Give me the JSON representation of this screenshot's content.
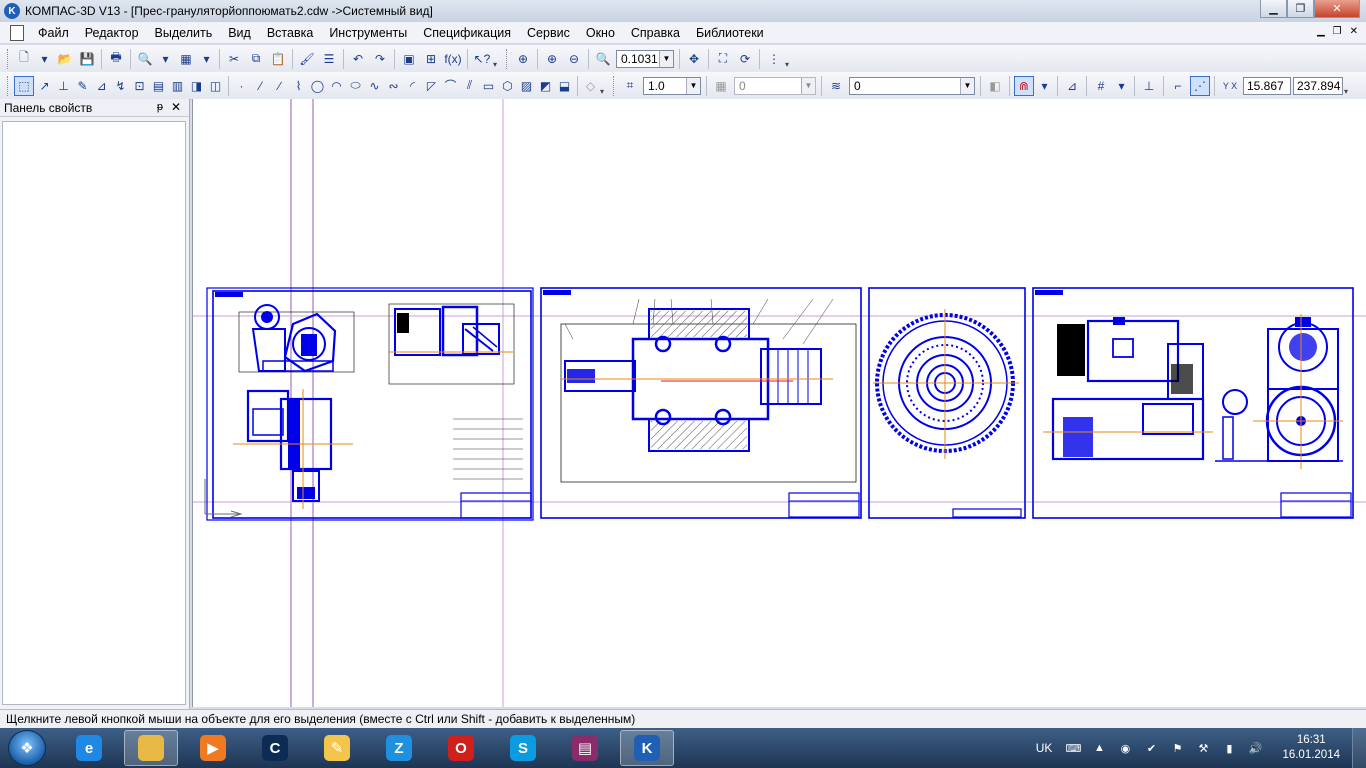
{
  "window": {
    "title": "КОМПАС-3D V13 - [Прес-грануляторйоппоюмать2.cdw ->Системный вид]",
    "minimize_icon": "minimize-icon",
    "maximize_icon": "maximize-icon",
    "close_icon": "close-icon"
  },
  "menu": {
    "items": [
      "Файл",
      "Редактор",
      "Выделить",
      "Вид",
      "Вставка",
      "Инструменты",
      "Спецификация",
      "Сервис",
      "Окно",
      "Справка",
      "Библиотеки"
    ]
  },
  "toolbar1": {
    "zoom_value": "0.1031"
  },
  "toolbar2": {
    "step_value": "1.0",
    "layer_value": "0",
    "style_value": "0",
    "coord_x": "15.867",
    "coord_y": "237.894",
    "coord_label": "Y X"
  },
  "property_panel": {
    "title": "Панель свойств",
    "pin_glyph": "ᵽ",
    "close_glyph": "✕"
  },
  "status": {
    "text": "Щелкните левой кнопкой мыши на объекте для его выделения (вместе с Ctrl или Shift - добавить к выделенным)"
  },
  "taskbar": {
    "apps": [
      {
        "name": "internet-explorer",
        "label": "e",
        "color": "#1e88e5"
      },
      {
        "name": "file-explorer",
        "label": "",
        "color": "#e8b847"
      },
      {
        "name": "media-player",
        "label": "▶",
        "color": "#f07a1f"
      },
      {
        "name": "ccleaner",
        "label": "C",
        "color": "#0c2c55"
      },
      {
        "name": "notepad-plus",
        "label": "✎",
        "color": "#f3c64b"
      },
      {
        "name": "zona",
        "label": "Z",
        "color": "#1f8fe0"
      },
      {
        "name": "opera",
        "label": "O",
        "color": "#d0201c"
      },
      {
        "name": "skype",
        "label": "S",
        "color": "#0a9be0"
      },
      {
        "name": "winrar",
        "label": "▤",
        "color": "#8a2c6a"
      },
      {
        "name": "kompas",
        "label": "K",
        "color": "#1f5fb4"
      }
    ],
    "language": "UK",
    "time": "16:31",
    "date": "16.01.2014"
  },
  "colors": {
    "drawing_blue": "#0000e8",
    "axis_orange": "#e58a1a",
    "guide_purple": "#9c5ab8"
  }
}
